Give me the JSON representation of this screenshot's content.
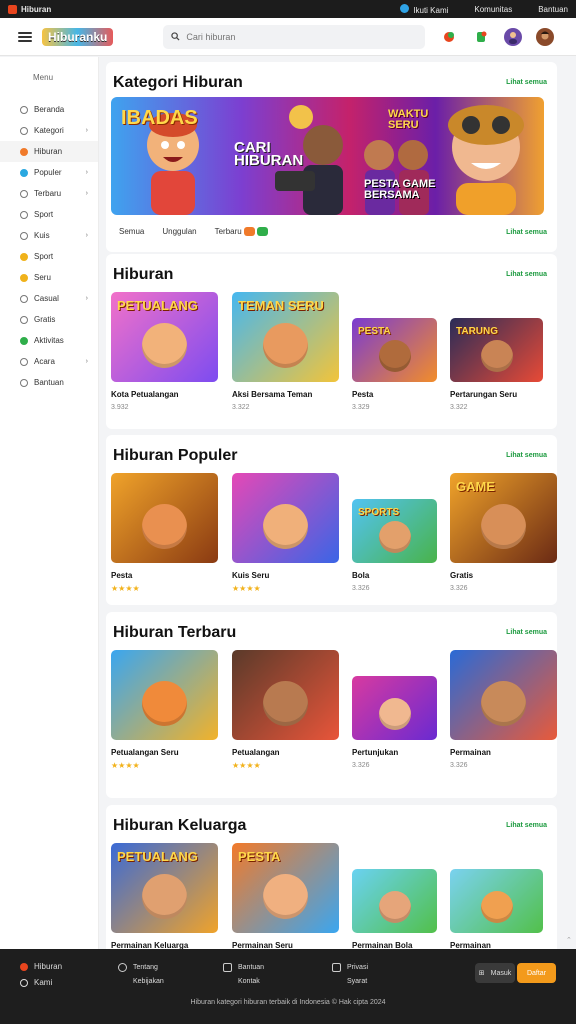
{
  "topbar": {
    "brand": "Hiburan",
    "links": [
      "Ikuti Kami",
      "Komunitas",
      "Bantuan"
    ]
  },
  "header": {
    "logo": "Hiburanku",
    "search_placeholder": "Cari hiburan"
  },
  "sidebar": {
    "title": "Menu",
    "items": [
      {
        "label": "Beranda",
        "icon": "home-icon",
        "arrow": ""
      },
      {
        "label": "Kategori",
        "icon": "grid-icon",
        "arrow": "›"
      },
      {
        "label": "Hiburan",
        "icon": "star-icon",
        "arrow": "",
        "active": true,
        "color": "#f07a2a"
      },
      {
        "label": "Populer",
        "icon": "fire-icon",
        "arrow": "›",
        "color": "#2aa8e0"
      },
      {
        "label": "Terbaru",
        "icon": "clock-icon",
        "arrow": "›"
      },
      {
        "label": "Sport",
        "icon": "ball-icon",
        "arrow": ""
      },
      {
        "label": "Kuis",
        "icon": "question-icon",
        "arrow": "›"
      },
      {
        "label": "Sport",
        "icon": "ball-icon",
        "arrow": "",
        "color": "#f0b21b"
      },
      {
        "label": "Seru",
        "icon": "smile-icon",
        "arrow": "",
        "color": "#f0b21b"
      },
      {
        "label": "Casual",
        "icon": "puzzle-icon",
        "arrow": "›"
      },
      {
        "label": "Gratis",
        "icon": "gift-icon",
        "arrow": ""
      },
      {
        "label": "Aktivitas",
        "icon": "activity-icon",
        "arrow": "",
        "color": "#2fae4a"
      },
      {
        "label": "Acara",
        "icon": "calendar-icon",
        "arrow": "›"
      },
      {
        "label": "Bantuan",
        "icon": "help-icon",
        "arrow": ""
      }
    ]
  },
  "featured": {
    "title": "Kategori Hiburan",
    "see_all": "Lihat semua",
    "banner_texts": [
      "IBADAS",
      "CARI HIBURAN",
      "WAKTU SERU",
      "PESTA GAME BERSAMA"
    ],
    "tabs": [
      "Semua",
      "Unggulan",
      "Terbaru"
    ],
    "tabs_link": "Lihat semua"
  },
  "sections": [
    {
      "title": "Hiburan",
      "see_all": "Lihat semua",
      "games": [
        {
          "name": "Kota Petualangan",
          "meta": "3.932",
          "thumb_text": "PETUALANG",
          "bg1": "#f271c9",
          "bg2": "#7d4cf0",
          "face": "#f2b27a"
        },
        {
          "name": "Aksi Bersama Teman",
          "meta": "3.322",
          "thumb_text": "TEMAN SERU",
          "bg1": "#45b7f0",
          "bg2": "#f2c43a",
          "face": "#e89a5f"
        },
        {
          "name": "Pesta",
          "meta": "3.329",
          "thumb_text": "PESTA",
          "bg1": "#7a3bd1",
          "bg2": "#f28d2a",
          "face": "#b06b3c"
        },
        {
          "name": "Pertarungan Seru",
          "meta": "3.322",
          "thumb_text": "TARUNG",
          "bg1": "#2a2c58",
          "bg2": "#e84a36",
          "face": "#c98455"
        }
      ]
    },
    {
      "title": "Hiburan Populer",
      "see_all": "Lihat semua",
      "games": [
        {
          "name": "Pesta",
          "stars": "★★★★",
          "thumb_text": "",
          "bg1": "#f0a32a",
          "bg2": "#8a3a12",
          "face": "#e99050"
        },
        {
          "name": "Kuis Seru",
          "stars": "★★★★",
          "thumb_text": "",
          "bg1": "#e548b6",
          "bg2": "#3a65e6",
          "face": "#f0b07a"
        },
        {
          "name": "Bola",
          "meta": "3.326",
          "thumb_text": "SPORTS",
          "bg1": "#52c3f2",
          "bg2": "#49b34a",
          "face": "#e3a06b"
        },
        {
          "name": "Gratis",
          "meta": "3.326",
          "thumb_text": "GAME",
          "bg1": "#f0a32a",
          "bg2": "#6b2a14",
          "face": "#d88f58"
        }
      ]
    },
    {
      "title": "Hiburan Terbaru",
      "see_all": "Lihat semua",
      "games": [
        {
          "name": "Petualangan Seru",
          "stars": "★★★★",
          "thumb_text": "",
          "bg1": "#3aa6f0",
          "bg2": "#f2b22a",
          "face": "#f08a3a"
        },
        {
          "name": "Petualangan",
          "stars": "★★★★",
          "thumb_text": "",
          "bg1": "#5a3a2a",
          "bg2": "#e8553a",
          "face": "#b87a50"
        },
        {
          "name": "Pertunjukan",
          "meta": "3.326",
          "thumb_text": "",
          "bg1": "#d83aa0",
          "bg2": "#6a2ad1",
          "face": "#f0b890"
        },
        {
          "name": "Permainan",
          "meta": "3.326",
          "thumb_text": "",
          "bg1": "#2a6ad6",
          "bg2": "#e85a3a",
          "face": "#c88a5a"
        }
      ]
    },
    {
      "title": "Hiburan Keluarga",
      "see_all": "Lihat semua",
      "games": [
        {
          "name": "Permainan Keluarga",
          "thumb_text": "PETUALANG",
          "bg1": "#3a6ad6",
          "bg2": "#f0a32a",
          "face": "#e0a070"
        },
        {
          "name": "Permainan Seru",
          "thumb_text": "PESTA",
          "bg1": "#f27a2a",
          "bg2": "#3aa6f0",
          "face": "#f0b080"
        },
        {
          "name": "Permainan Bola",
          "thumb_text": "",
          "bg1": "#6ad2f2",
          "bg2": "#52c04a",
          "face": "#e6a57a"
        },
        {
          "name": "Permainan",
          "thumb_text": "",
          "bg1": "#7ad2f0",
          "bg2": "#52c04a",
          "face": "#f0a050"
        }
      ]
    }
  ],
  "footer": {
    "brand": [
      "Hiburan",
      "Kami"
    ],
    "col1": [
      "Tentang",
      "Kebijakan"
    ],
    "col2": [
      "Bantuan",
      "Kontak"
    ],
    "col3": [
      "Privasi",
      "Syarat"
    ],
    "btn1": "Masuk",
    "btn2": "Daftar",
    "copyright": "Hiburan kategori hiburan terbaik di Indonesia © Hak cipta 2024"
  }
}
